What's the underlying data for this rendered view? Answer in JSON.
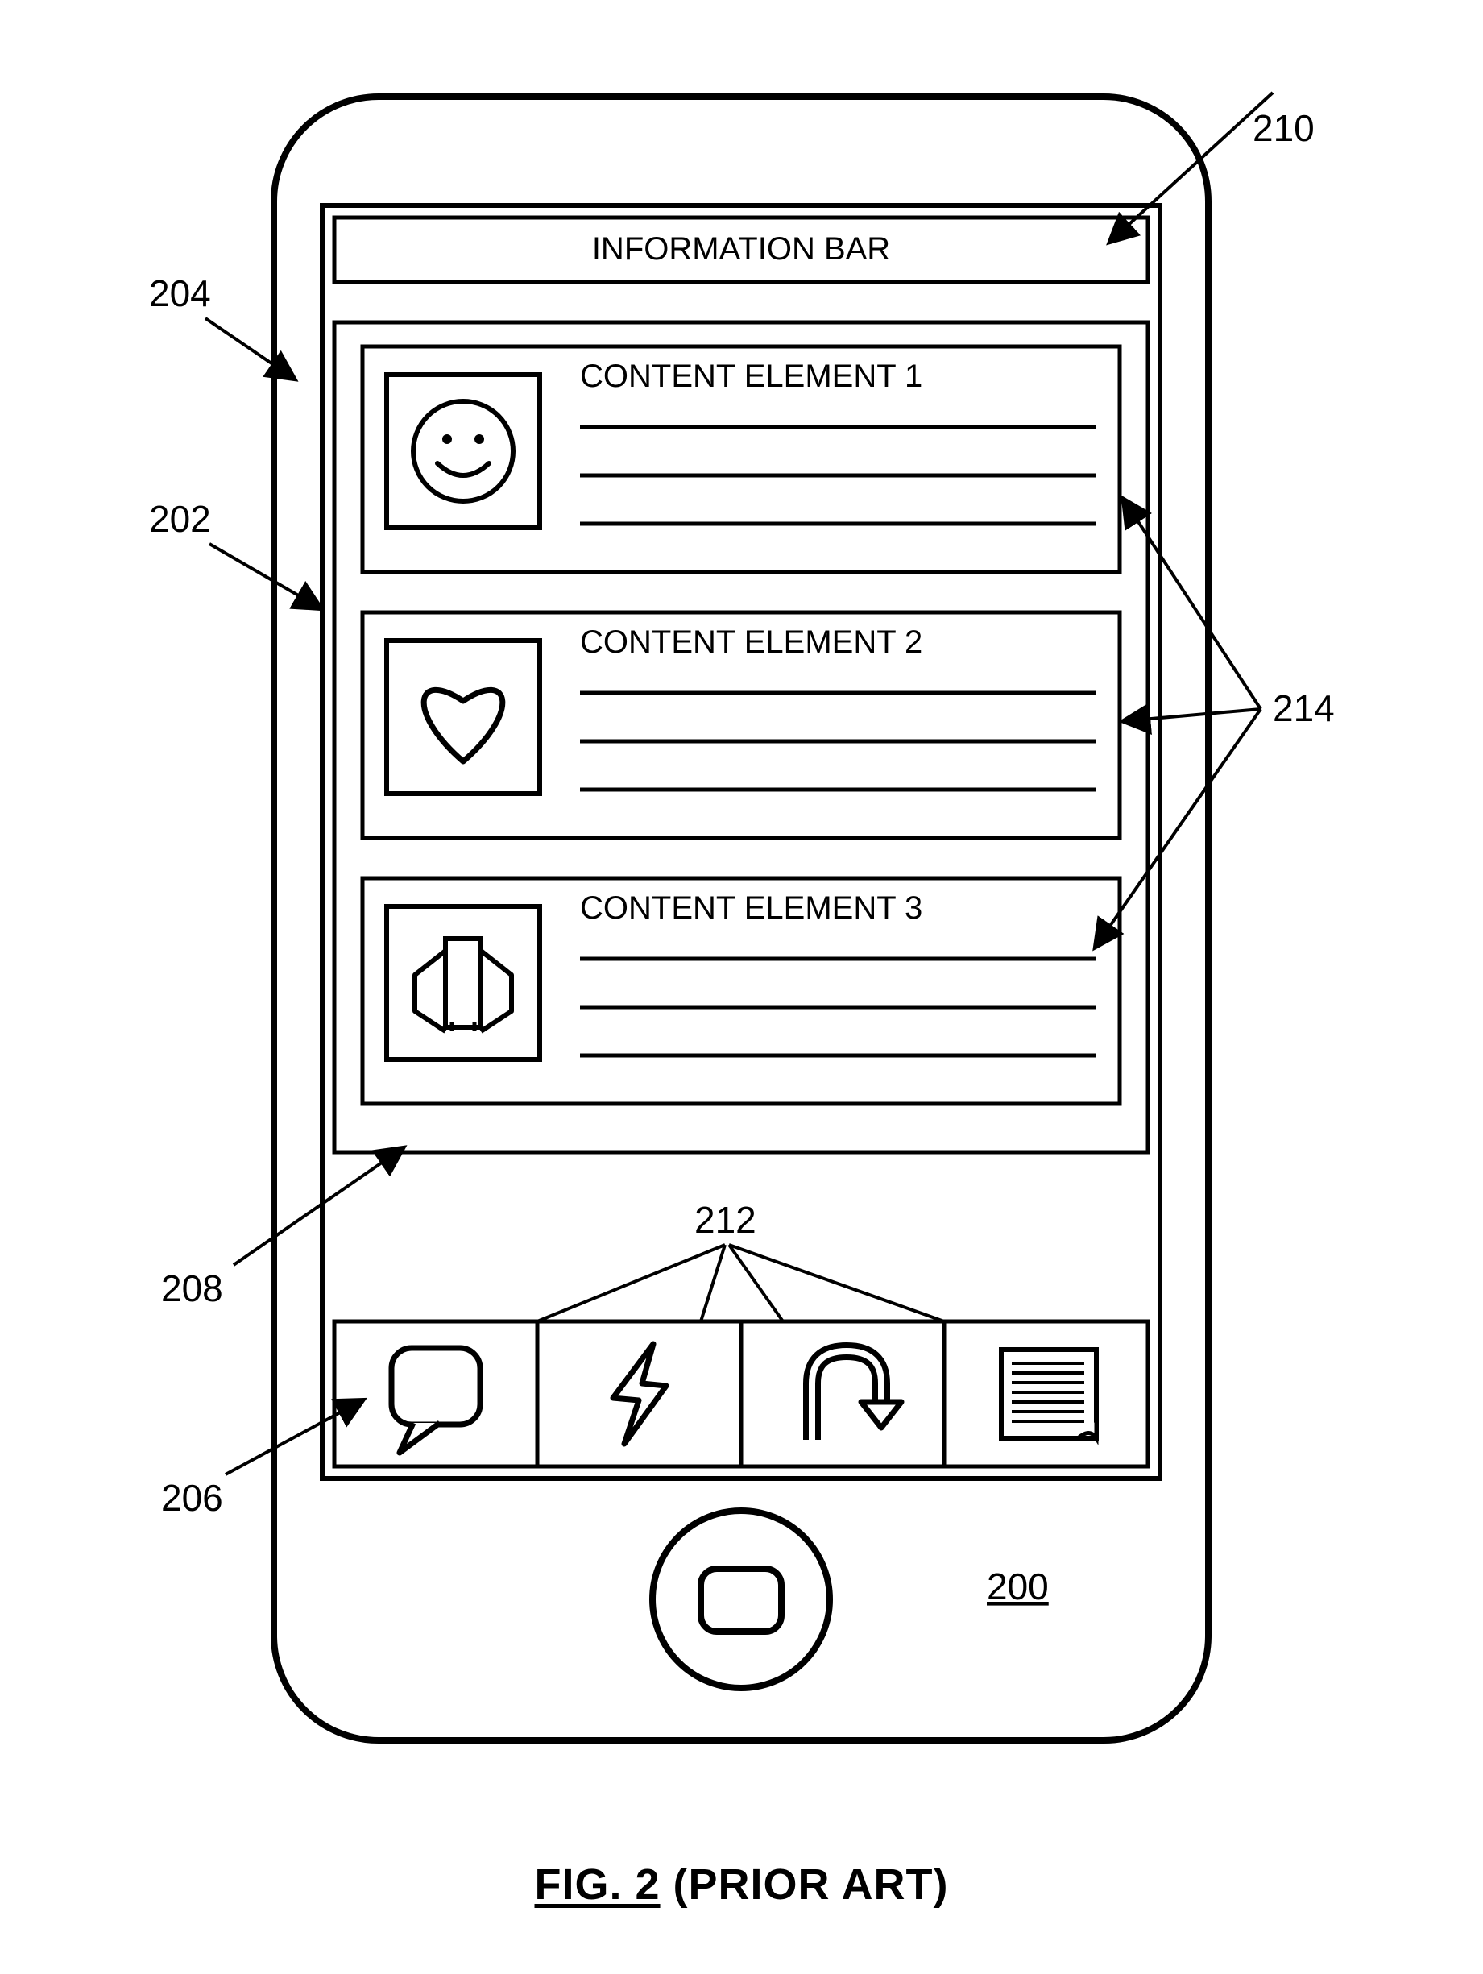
{
  "figure": {
    "number_label": "FIG. 2",
    "suffix": " (PRIOR ART)"
  },
  "info_bar": {
    "title": "INFORMATION BAR"
  },
  "content": {
    "items": [
      {
        "title": "CONTENT ELEMENT 1",
        "icon": "smiley"
      },
      {
        "title": "CONTENT ELEMENT 2",
        "icon": "heart"
      },
      {
        "title": "CONTENT ELEMENT 3",
        "icon": "ribbon"
      }
    ]
  },
  "nav": {
    "items": [
      {
        "icon": "speech-bubble"
      },
      {
        "icon": "lightning"
      },
      {
        "icon": "u-turn-arrow"
      },
      {
        "icon": "document"
      }
    ]
  },
  "refs": {
    "r200": "200",
    "r202": "202",
    "r204": "204",
    "r206": "206",
    "r208": "208",
    "r210": "210",
    "r212": "212",
    "r214": "214"
  }
}
